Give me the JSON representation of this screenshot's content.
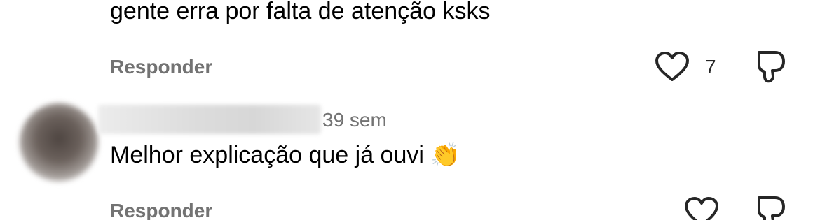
{
  "comment_one": {
    "text_tail": "gente erra por falta de atenção ksks",
    "reply_label": "Responder",
    "like_count": "7"
  },
  "comment_two": {
    "time": "39 sem",
    "text": "Melhor explicação que já ouvi",
    "emoji": "👏",
    "reply_label": "Responder"
  },
  "icons": {
    "like": "heart-icon",
    "dislike": "thumbs-down-icon"
  },
  "colors": {
    "muted_text": "#737373",
    "icon_stroke": "#262626"
  }
}
